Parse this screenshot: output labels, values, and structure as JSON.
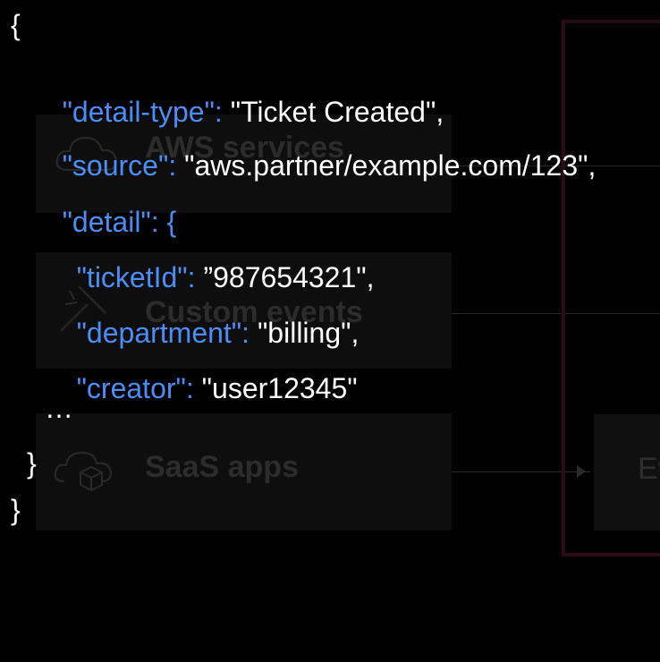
{
  "background": {
    "sources": [
      {
        "label": "AWS services",
        "icon": "cloud-icon"
      },
      {
        "label": "Custom events",
        "icon": "tools-icon"
      },
      {
        "label": "SaaS apps",
        "icon": "cloud-box-icon"
      }
    ],
    "event_bus_label": "Ev"
  },
  "code": {
    "open_brace": "{",
    "close_brace": "}",
    "lines": [
      {
        "key": "\"detail-type\":",
        "value": " \"Ticket Created\","
      },
      {
        "key": "\"source\":",
        "value": " \"aws.partner/example.com/123\","
      },
      {
        "key": "\"detail\":",
        "value": " {"
      },
      {
        "key": "\"ticketId\":",
        "value": " ”987654321\","
      },
      {
        "key": "\"department\":",
        "value": " \"billing\","
      },
      {
        "key": "\"creator\":",
        "value": " \"user12345\""
      }
    ],
    "ellipsis": "…",
    "detail_close": "}"
  },
  "colors": {
    "key": "#4c8df6",
    "value": "#ffffff",
    "background": "#000000",
    "bus_border": "#2b0c14"
  }
}
